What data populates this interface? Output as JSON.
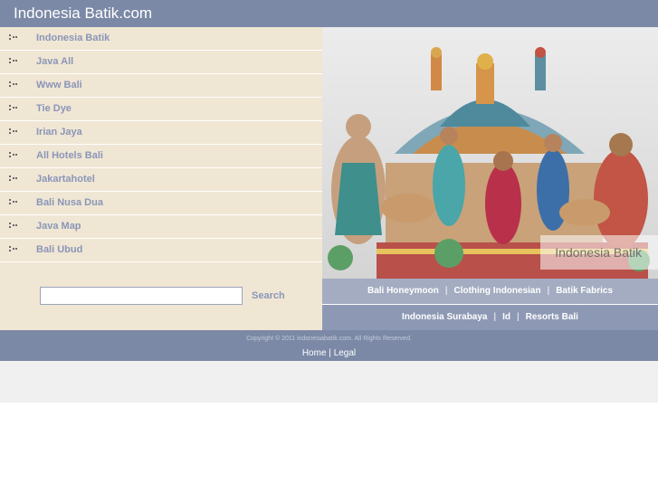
{
  "header": {
    "title": "Indonesia Batik.com"
  },
  "sidebar": {
    "items": [
      {
        "label": "Indonesia Batik"
      },
      {
        "label": "Java All"
      },
      {
        "label": "Www Bali"
      },
      {
        "label": "Tie Dye"
      },
      {
        "label": "Irian Jaya"
      },
      {
        "label": "All Hotels Bali"
      },
      {
        "label": "Jakartahotel"
      },
      {
        "label": "Bali Nusa Dua"
      },
      {
        "label": "Java Map"
      },
      {
        "label": "Bali Ubud"
      }
    ]
  },
  "search": {
    "value": "",
    "button_label": "Search"
  },
  "hero": {
    "caption": "Indonesia Batik"
  },
  "links_row1": [
    "Bali Honeymoon",
    "Clothing Indonesian",
    "Batik Fabrics"
  ],
  "links_row2": [
    "Indonesia Surabaya",
    "Id",
    "Resorts Bali"
  ],
  "separator": "|",
  "footer": {
    "copyright": "Copyright © 2011 indonesiabatik.com. All Rights Reserved.",
    "links": [
      "Home",
      "Legal"
    ],
    "link_separator": "|"
  },
  "colors": {
    "header": "#7b89a6",
    "sidebar": "#f0e6d4",
    "nav_text": "#8a96b8"
  },
  "icons": {
    "bullet": "dotted-bullet-icon"
  }
}
